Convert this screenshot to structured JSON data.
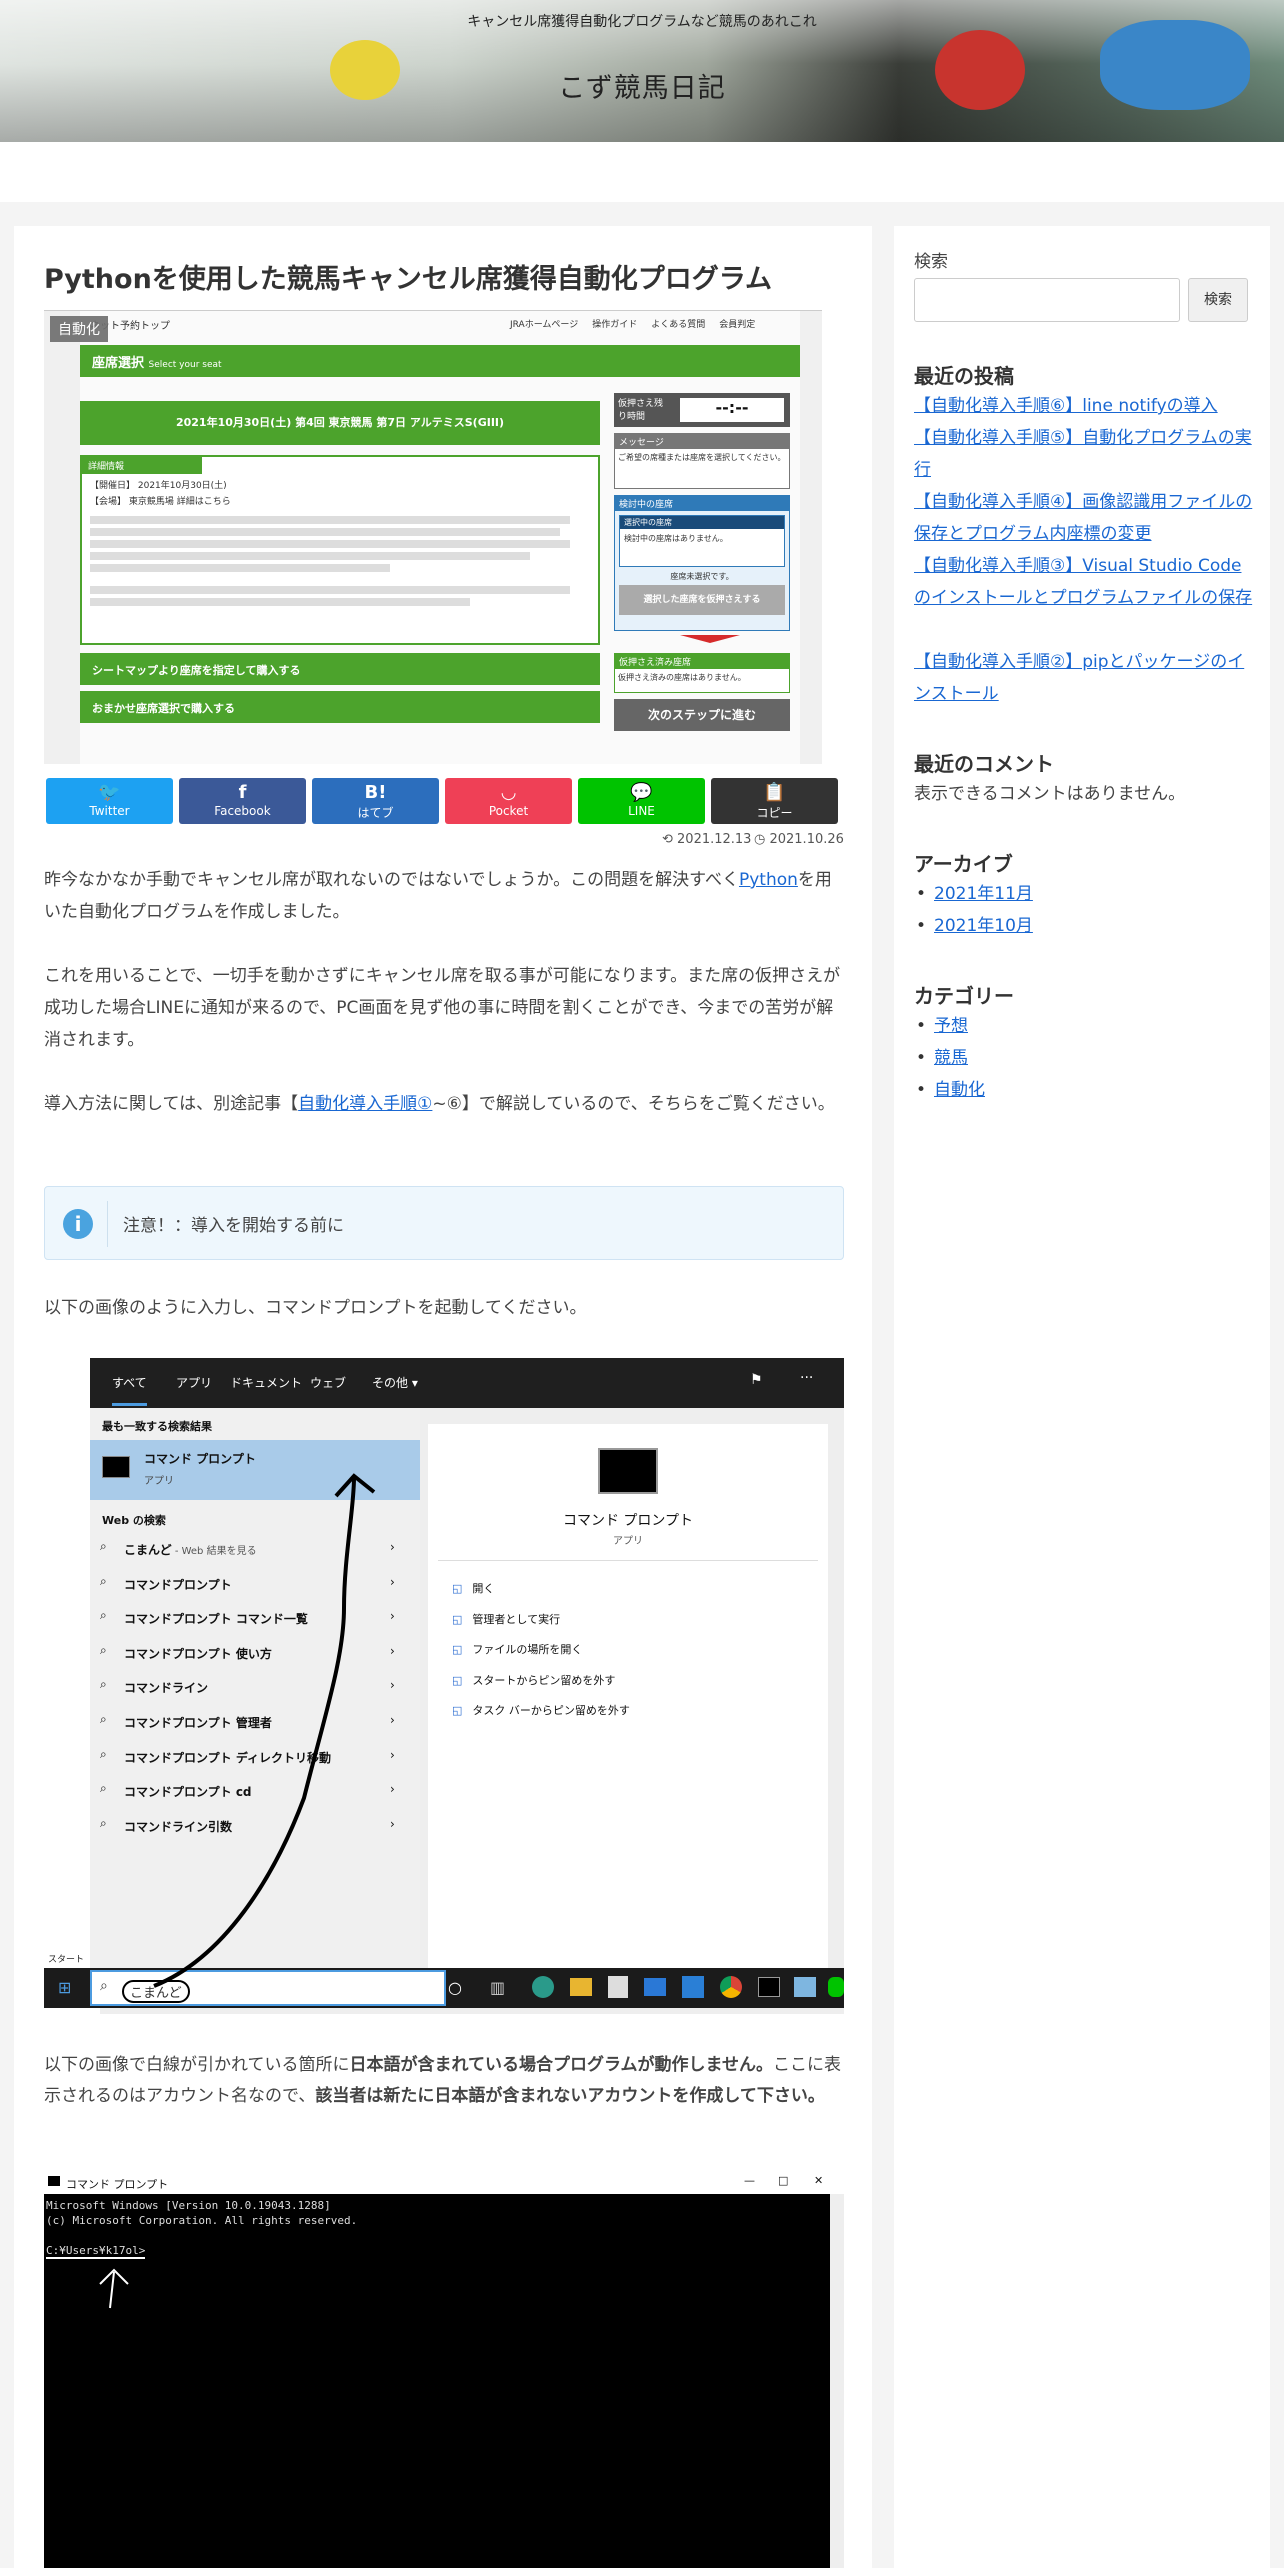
{
  "header": {
    "tagline": "キャンセル席獲得自動化プログラムなど競馬のあれこれ",
    "site_title": "こず競馬日記"
  },
  "article": {
    "title": "Pythonを使用した競馬キャンセル席獲得自動化プログラム",
    "category_badge": "自動化",
    "eyecatch": {
      "nav_left": "ネット予約トップ",
      "nav_right": [
        "JRAホームページ",
        "操作ガイド",
        "よくある質問",
        "会員判定"
      ],
      "seat_select": "座席選択",
      "seat_select_en": "Select your seat",
      "race_title": "2021年10月30日(土) 第4回 東京競馬 第7日 アルテミスS(GIII)",
      "detail_header": "詳細情報",
      "detail_date": "【開催日】 2021年10月30日(土)",
      "detail_place": "【会場】 東京競馬場 詳細はこちら",
      "btn_seatmap": "シートマップより座席を指定して購入する",
      "btn_omakase": "おまかせ座席選択で購入する",
      "hold_time_label": "仮押さえ残り時間",
      "hold_time_value": "--:--",
      "message_label": "メッセージ",
      "message_text": "ご希望の席種または座席を選択してください。",
      "consider_label": "検討中の座席",
      "selecting_label": "選択中の座席",
      "selecting_text": "検討中の座席はありません。",
      "not_selected": "座席未選択です。",
      "hold_btn": "選択した座席を仮押さえする",
      "held_label": "仮押さえ済み座席",
      "held_text": "仮押さえ済みの座席はありません。",
      "next_btn": "次のステップに進む"
    },
    "share": [
      {
        "name": "twitter",
        "glyph": "🐦",
        "label": "Twitter",
        "color": "#1da1f2"
      },
      {
        "name": "facebook",
        "glyph": "f",
        "label": "Facebook",
        "color": "#3b5998"
      },
      {
        "name": "hatebu",
        "glyph": "B!",
        "label": "はてブ",
        "color": "#2c6ebd"
      },
      {
        "name": "pocket",
        "glyph": "◡",
        "label": "Pocket",
        "color": "#ef4056"
      },
      {
        "name": "line",
        "glyph": "💬",
        "label": "LINE",
        "color": "#00c300"
      },
      {
        "name": "copy",
        "glyph": "📋",
        "label": "コピー",
        "color": "#333333"
      }
    ],
    "date_updated": "⟲ 2021.12.13",
    "date_published": "◷ 2021.10.26",
    "p1_before": "昨今なかなか手動でキャンセル席が取れないのではないでしょうか。この問題を解決すべく",
    "p1_link": "Python",
    "p1_after": "を用いた自動化プログラムを作成しました。",
    "p2": "これを用いることで、一切手を動かさずにキャンセル席を取る事が可能になります。また席の仮押さえが成功した場合LINEに通知が来るので、PC画面を見ず他の事に時間を割くことができ、今までの苦労が解消されます。",
    "p3_before": "導入方法に関しては、別途記事【",
    "p3_link": "自動化導入手順①",
    "p3_after": "~⑥】で解説しているので、そちらをご覧ください。",
    "notice": "注意！：導入を開始する前に",
    "p4": "以下の画像のように入力し、コマンドプロンプトを起動してください。",
    "win_search": {
      "tabs": [
        "すべて",
        "アプリ",
        "ドキュメント",
        "ウェブ",
        "その他 ▾"
      ],
      "best_match_label": "最も一致する検索結果",
      "best_match_title": "コマンド プロンプト",
      "best_match_sub": "アプリ",
      "web_search_label": "Web の検索",
      "results": [
        {
          "text": "こまんど",
          "suffix": " - Web 結果を見る"
        },
        {
          "text": "コマンドプロンプト",
          "suffix": ""
        },
        {
          "text": "コマンドプロンプト コマンド一覧",
          "suffix": ""
        },
        {
          "text": "コマンドプロンプト 使い方",
          "suffix": ""
        },
        {
          "text": "コマンドライン",
          "suffix": ""
        },
        {
          "text": "コマンドプロンプト 管理者",
          "suffix": ""
        },
        {
          "text": "コマンドプロンプト ディレクトリ移動",
          "suffix": ""
        },
        {
          "text": "コマンドプロンプト cd",
          "suffix": ""
        },
        {
          "text": "コマンドライン引数",
          "suffix": ""
        }
      ],
      "preview_title": "コマンド プロンプト",
      "preview_sub": "アプリ",
      "actions": [
        "開く",
        "管理者として実行",
        "ファイルの場所を開く",
        "スタートからピン留めを外す",
        "タスク バーからピン留めを外す"
      ],
      "search_value": "こまんど",
      "start_label": "スタート"
    },
    "p5_a": "以下の画像で白線が引かれている箇所に",
    "p5_b": "日本語が含まれている場合プログラムが動作しません。",
    "p5_c": "ここに表示されるのはアカウント名なので、",
    "p5_d": "該当者は新たに日本語が含まれないアカウントを作成して下さい。",
    "cmd": {
      "title": "コマンド プロンプト",
      "line1": "Microsoft Windows [Version 10.0.19043.1288]",
      "line2": "(c) Microsoft Corporation. All rights reserved.",
      "line3": "C:¥Users¥k17ol>"
    }
  },
  "sidebar": {
    "search_heading": "検索",
    "search_placeholder": "",
    "search_button": "検索",
    "recent_heading": "最近の投稿",
    "recent_posts": [
      "【自動化導入手順⑥】line notifyの導入",
      "【自動化導入手順⑤】自動化プログラムの実行",
      "【自動化導入手順④】画像認識用ファイルの保存とプログラム内座標の変更",
      "【自動化導入手順③】Visual Studio Codeのインストールとプログラムファイルの保存",
      "【自動化導入手順②】pipとパッケージのインストール"
    ],
    "comments_heading": "最近のコメント",
    "comments_text": "表示できるコメントはありません。",
    "archive_heading": "アーカイブ",
    "archives": [
      "2021年11月",
      "2021年10月"
    ],
    "category_heading": "カテゴリー",
    "categories": [
      "予想",
      "競馬",
      "自動化"
    ]
  }
}
